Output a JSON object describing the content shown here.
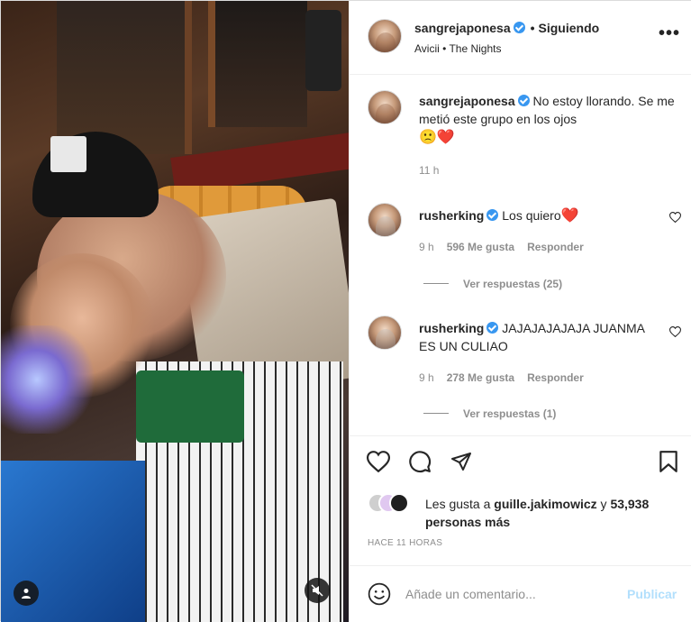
{
  "post": {
    "username": "sangrejaponesa",
    "follow_status": "Siguiendo",
    "audio": "Avicii • The Nights",
    "more_glyph": "•••"
  },
  "caption": {
    "username": "sangrejaponesa",
    "text": "No estoy llorando. Se me metió este grupo en los ojos",
    "emojis": "🙁❤️",
    "time": "11 h"
  },
  "comments": [
    {
      "username": "rusherking",
      "text": "Los quiero",
      "emoji": "❤️",
      "time": "9 h",
      "likes": "596 Me gusta",
      "reply": "Responder",
      "view_replies": "Ver respuestas (25)"
    },
    {
      "username": "rusherking",
      "text": "JAJAJAJAJAJA JUANMA ES UN CULIAO",
      "emoji": "",
      "time": "9 h",
      "likes": "278 Me gusta",
      "reply": "Responder",
      "view_replies": "Ver respuestas (1)"
    }
  ],
  "likes": {
    "prefix": "Les gusta a",
    "user": "guille.jakimowicz",
    "conj": "y",
    "others": "53,938 personas más"
  },
  "timestamp": "HACE 11 HORAS",
  "add_comment": {
    "placeholder": "Añade un comentario...",
    "publish_label": "Publicar"
  },
  "icons": {
    "heart": "heart-icon",
    "comment": "comment-icon",
    "share": "share-icon",
    "save": "bookmark-icon",
    "emoji": "smile-icon",
    "user": "user-tag-icon",
    "mute": "mute-icon"
  },
  "colors": {
    "verified": "#3897f0",
    "publish_disabled": "#b2dffc",
    "meta": "#8e8e8e"
  }
}
